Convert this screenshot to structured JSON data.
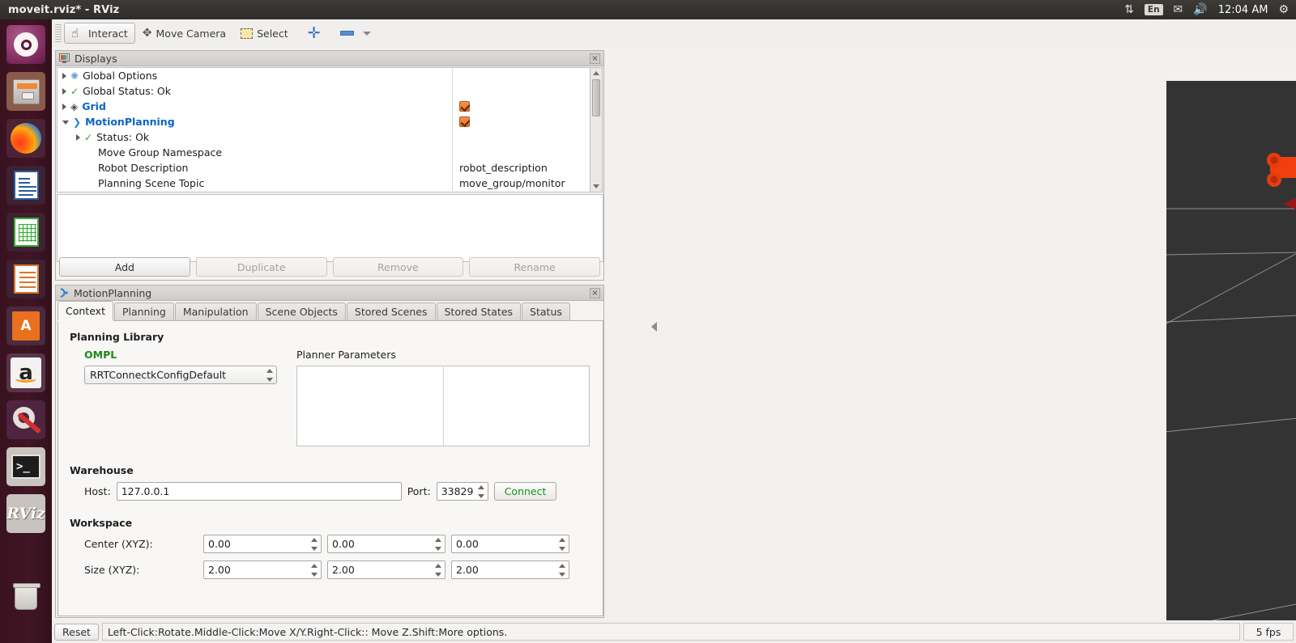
{
  "window": {
    "title": "moveit.rviz* - RViz"
  },
  "top_panel": {
    "icons": [
      "network-icon",
      "keyboard-layout-icon",
      "mail-icon",
      "volume-icon"
    ],
    "keyboard_layout": "En",
    "clock": "12:04 AM",
    "session_icon": "power-gear-icon"
  },
  "launcher": {
    "items": [
      {
        "name": "ubuntu-dash",
        "label": "Ubuntu",
        "active": false
      },
      {
        "name": "files",
        "label": "Files",
        "active": true
      },
      {
        "name": "firefox",
        "label": "Firefox",
        "active": false
      },
      {
        "name": "libreoffice-writer",
        "label": "LibreOffice Writer",
        "active": false
      },
      {
        "name": "libreoffice-calc",
        "label": "LibreOffice Calc",
        "active": false
      },
      {
        "name": "libreoffice-impress",
        "label": "LibreOffice Impress",
        "active": false
      },
      {
        "name": "software-center",
        "label": "Ubuntu Software Center",
        "active": false
      },
      {
        "name": "amazon",
        "label": "Amazon",
        "active": false
      },
      {
        "name": "system-settings",
        "label": "System Settings",
        "active": false
      },
      {
        "name": "terminal",
        "label": "Terminal",
        "active": true
      },
      {
        "name": "rviz",
        "label": "RViz",
        "active": true
      },
      {
        "name": "trash",
        "label": "Trash",
        "active": false
      }
    ]
  },
  "toolbar": {
    "interact_label": "Interact",
    "move_camera_label": "Move Camera",
    "select_label": "Select",
    "add_tool_label": "+",
    "remove_tool_label": "-"
  },
  "displays_panel": {
    "title": "Displays",
    "close_label": "×",
    "tree": [
      {
        "label": "Global Options",
        "icon": "gear-icon",
        "arrow": "collapsed",
        "indent": 0,
        "style": "plain",
        "value": "",
        "checkbox": "none"
      },
      {
        "label": "Global Status: Ok",
        "icon": "check-icon",
        "arrow": "collapsed",
        "indent": 0,
        "style": "plain",
        "value": "",
        "checkbox": "none"
      },
      {
        "label": "Grid",
        "icon": "grid-icon",
        "arrow": "collapsed",
        "indent": 0,
        "style": "blue",
        "value": "",
        "checkbox": "checked"
      },
      {
        "label": "MotionPlanning",
        "icon": "motionplanning-icon",
        "arrow": "expanded",
        "indent": 0,
        "style": "blue",
        "value": "",
        "checkbox": "checked"
      },
      {
        "label": "Status: Ok",
        "icon": "check-icon",
        "arrow": "collapsed",
        "indent": 1,
        "style": "plain",
        "value": "",
        "checkbox": "none"
      },
      {
        "label": "Move Group Namespace",
        "icon": "none",
        "arrow": "none",
        "indent": 2,
        "style": "plain",
        "value": "",
        "checkbox": "none"
      },
      {
        "label": "Robot Description",
        "icon": "none",
        "arrow": "none",
        "indent": 2,
        "style": "plain",
        "value": "robot_description",
        "checkbox": "none"
      },
      {
        "label": "Planning Scene Topic",
        "icon": "none",
        "arrow": "none",
        "indent": 2,
        "style": "plain",
        "value": "move_group/monitor",
        "checkbox": "none"
      }
    ],
    "buttons": [
      {
        "label": "Add",
        "enabled": true
      },
      {
        "label": "Duplicate",
        "enabled": false
      },
      {
        "label": "Remove",
        "enabled": false
      },
      {
        "label": "Rename",
        "enabled": false
      }
    ]
  },
  "motion_planning_panel": {
    "title": "MotionPlanning",
    "close_label": "×",
    "tabs": [
      {
        "label": "Context",
        "active": true
      },
      {
        "label": "Planning",
        "active": false
      },
      {
        "label": "Manipulation",
        "active": false
      },
      {
        "label": "Scene Objects",
        "active": false
      },
      {
        "label": "Stored Scenes",
        "active": false
      },
      {
        "label": "Stored States",
        "active": false
      },
      {
        "label": "Status",
        "active": false
      }
    ],
    "context": {
      "planning_library_heading": "Planning Library",
      "ompl_label": "OMPL",
      "planner_config_value": "RRTConnectkConfigDefault",
      "planner_parameters_label": "Planner Parameters",
      "warehouse_heading": "Warehouse",
      "host_label": "Host:",
      "host_value": "127.0.0.1",
      "port_label": "Port:",
      "port_value": "33829",
      "connect_label": "Connect",
      "workspace_heading": "Workspace",
      "center_label": "Center (XYZ):",
      "center_values": [
        "0.00",
        "0.00",
        "0.00"
      ],
      "size_label": "Size (XYZ):",
      "size_values": [
        "2.00",
        "2.00",
        "2.00"
      ]
    }
  },
  "viewport": {
    "background_color": "#333333",
    "grid_line_color": "#b4b4b4",
    "robot_color": "#f04010",
    "robot_base_color": "#cc1006",
    "marker_ring_color": "#22b822",
    "marker_arrow_z_color": "#2233cc",
    "marker_arrow_x_color": "#a81818",
    "marker_sphere_color": "#2fb8a8"
  },
  "status_bar": {
    "reset_label": "Reset",
    "hint_parts": [
      {
        "text": "Left-Click:",
        "bold": true
      },
      {
        "text": " Rotate. ",
        "bold": false
      },
      {
        "text": "Middle-Click:",
        "bold": true
      },
      {
        "text": " Move X/Y. ",
        "bold": false
      },
      {
        "text": "Right-Click:",
        "bold": true
      },
      {
        "text": ": Move Z. ",
        "bold": false
      },
      {
        "text": "Shift:",
        "bold": true
      },
      {
        "text": " More options.",
        "bold": false
      }
    ],
    "fps": "5 fps"
  }
}
